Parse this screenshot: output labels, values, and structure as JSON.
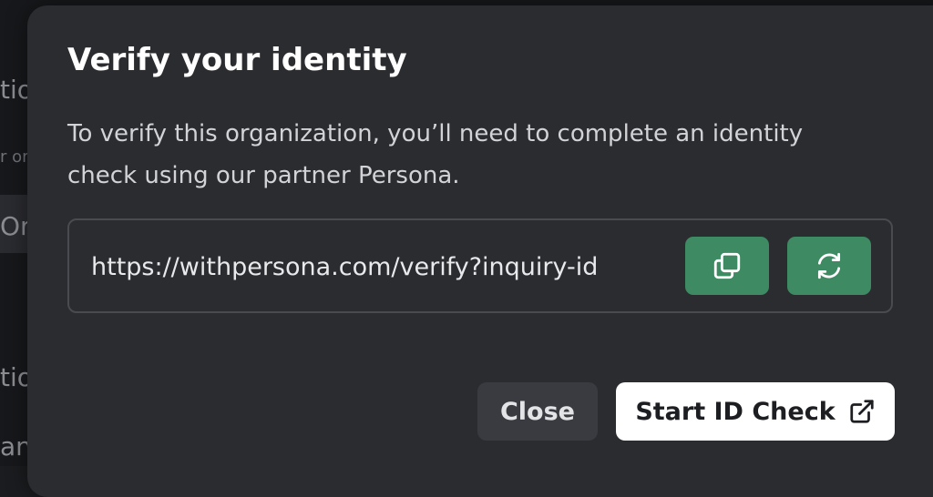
{
  "background": {
    "fragments": [
      "tio",
      "r or",
      "Org",
      "tio",
      "an"
    ]
  },
  "dialog": {
    "title": "Verify your identity",
    "description": "To verify this organization, you’ll need to complete an identity check using our partner Persona.",
    "url_value": "https://withpersona.com/verify?inquiry-id",
    "copy_icon": "copy-icon",
    "refresh_icon": "refresh-icon",
    "close_label": "Close",
    "start_label": "Start ID Check",
    "start_icon": "external-link-icon"
  },
  "colors": {
    "modal_bg": "#2b2c30",
    "accent_green": "#3d8a63",
    "primary_button": "#ffffff",
    "secondary_button": "#3a3b40"
  }
}
